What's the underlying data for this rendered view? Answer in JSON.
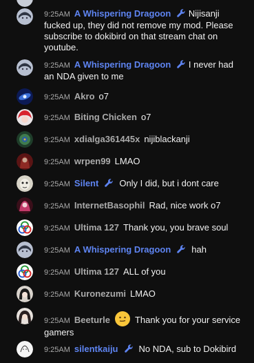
{
  "messages": [
    {
      "time": "9:25AM",
      "author": "A Whispering Dragoon",
      "mod": true,
      "text": "Nijisanji fucked up, they did not remove my mod. Please subscribe to dokibird on that stream chat on youtube.",
      "avatar": "anime-girl-avatar"
    },
    {
      "time": "9:25AM",
      "author": "A Whispering Dragoon",
      "mod": true,
      "text": "I never had an NDA given to me",
      "avatar": "anime-girl-avatar"
    },
    {
      "time": "9:25AM",
      "author": "Akro",
      "mod": false,
      "text": "o7",
      "avatar": "galaxy-avatar"
    },
    {
      "time": "9:25AM",
      "author": "Biting Chicken",
      "mod": false,
      "text": "o7",
      "avatar": "red-hair-avatar"
    },
    {
      "time": "9:25AM",
      "author": "xdialga361445x",
      "mod": false,
      "text": "nijiblackanji",
      "avatar": "feather-avatar"
    },
    {
      "time": "9:25AM",
      "author": "wrpen99",
      "mod": false,
      "text": "LMAO",
      "avatar": "dark-red-avatar"
    },
    {
      "time": "9:25AM",
      "author": "Silent",
      "mod": true,
      "text": "Only I did, but i dont care",
      "avatar": "pale-face-avatar"
    },
    {
      "time": "9:25AM",
      "author": "InternetBasophil",
      "mod": false,
      "text": "Rad, nice work o7",
      "avatar": "pink-character-avatar"
    },
    {
      "time": "9:25AM",
      "author": "Ultima 127",
      "mod": false,
      "text": "Thank you, you brave soul",
      "avatar": "trinity-knot-avatar"
    },
    {
      "time": "9:25AM",
      "author": "A Whispering Dragoon",
      "mod": true,
      "text": "hah",
      "avatar": "anime-girl-avatar"
    },
    {
      "time": "9:25AM",
      "author": "Ultima 127",
      "mod": false,
      "text": "ALL of you",
      "avatar": "trinity-knot-avatar"
    },
    {
      "time": "9:25AM",
      "author": "Kuronezumi",
      "mod": false,
      "text": "LMAO",
      "avatar": "dark-hair-avatar"
    },
    {
      "time": "9:25AM",
      "author": "Beeturle",
      "mod": false,
      "text": "Thank you for your service gamers",
      "avatar": "dark-hair-girl-avatar",
      "emoji": "slight-smile-emoji"
    },
    {
      "time": "9:25AM",
      "author": "silentkaiju",
      "mod": true,
      "text": "No NDA, sub to Dokibird",
      "avatar": "white-sketch-avatar"
    }
  ],
  "colors": {
    "background": "#0f0f0f",
    "moderator_name": "#5e84f1",
    "author_name": "#aaaaaa",
    "timestamp": "#aaaaaa",
    "message_text": "#f1f1f1"
  }
}
